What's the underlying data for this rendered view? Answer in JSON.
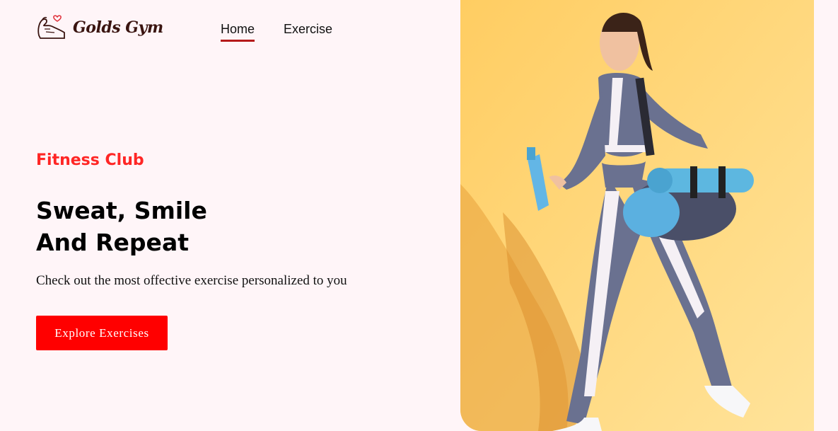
{
  "brand": {
    "name": "Golds Gym",
    "logo_icon": "flexed-arm-heart-icon"
  },
  "nav": {
    "items": [
      {
        "label": "Home",
        "active": true
      },
      {
        "label": "Exercise",
        "active": false
      }
    ],
    "active_color": "#b51a1a"
  },
  "hero": {
    "eyebrow": "Fitness Club",
    "headline_line1": "Sweat, Smile",
    "headline_line2": "And Repeat",
    "subtitle": "Check out the most offective exercise personalized to you",
    "cta_label": "Explore Exercises",
    "image": "woman-with-gym-bag-and-yoga-mat-photo"
  },
  "colors": {
    "accent": "#ff2625",
    "cta_background": "#ff0000",
    "page_background": "#fff5f8",
    "image_background": "#ffd478"
  }
}
